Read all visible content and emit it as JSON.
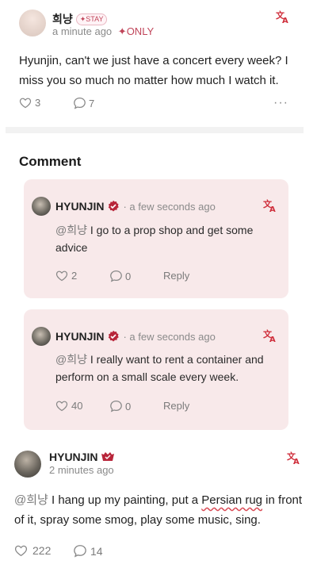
{
  "post": {
    "username": "희냥",
    "badge": "✦STAY",
    "time": "a minute ago",
    "visibility": "✦ONLY",
    "text": "Hyunjin, can't we just have a concert every week? I miss you so much no matter how much I watch it.",
    "likes": "3",
    "comments": "7"
  },
  "comment_section": {
    "title": "Comment"
  },
  "replies": [
    {
      "name": "HYUNJIN",
      "time": "· a few seconds ago",
      "mention": "@희냥",
      "text": " I go to a prop shop and get some advice",
      "likes": "2",
      "comments": "0",
      "reply_label": "Reply"
    },
    {
      "name": "HYUNJIN",
      "time": "· a few seconds ago",
      "mention": "@희냥",
      "text": " I really want to rent a container and perform on a small scale every week.",
      "likes": "40",
      "comments": "0",
      "reply_label": "Reply"
    }
  ],
  "bottom_post": {
    "name": "HYUNJIN",
    "time": "2 minutes ago",
    "mention": "@희냥",
    "text_before": " I hang up my painting, put a ",
    "highlight": "Persian rug",
    "text_after": " in front of it, spray some smog, play some music, sing.",
    "likes": "222",
    "comments": "14"
  },
  "colors": {
    "accent_red": "#cf2e3b",
    "card_bg": "#f8e9ea"
  },
  "icons": [
    "translate-icon",
    "heart-icon",
    "comment-icon",
    "more-icon",
    "verified-badge-icon"
  ]
}
